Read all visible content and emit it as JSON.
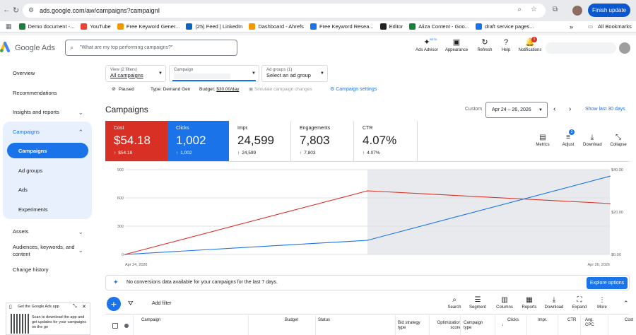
{
  "browser": {
    "url": "ads.google.com/aw/campaigns?campaignI",
    "finish_update": "Finish update",
    "bookmarks": [
      {
        "label": "Demo document -...",
        "color": "#188038"
      },
      {
        "label": "YouTube",
        "color": "#ea4335"
      },
      {
        "label": "Free Keyword Gener...",
        "color": "#f29900"
      },
      {
        "label": "(25) Feed | LinkedIn",
        "color": "#0a66c2"
      },
      {
        "label": "Dashboard - Ahrefs",
        "color": "#f29900"
      },
      {
        "label": "Free Keyword Resea...",
        "color": "#1a73e8"
      },
      {
        "label": "Editor",
        "color": "#202124"
      },
      {
        "label": "Aliza Content - Goo...",
        "color": "#188038"
      },
      {
        "label": "draft service pages...",
        "color": "#1a73e8"
      }
    ],
    "more_bookmarks": "»",
    "all_bookmarks": "All Bookmarks"
  },
  "header": {
    "brand": "Google Ads",
    "search_placeholder": "\"What are my top performing campaigns?\"",
    "icons": [
      {
        "label": "Ads Advisor",
        "glyph": "✦",
        "badge": "BETA"
      },
      {
        "label": "Appearance",
        "glyph": "▣"
      },
      {
        "label": "Refresh",
        "glyph": "↻"
      },
      {
        "label": "Help",
        "glyph": "?"
      },
      {
        "label": "Notifications",
        "glyph": "🔔",
        "badge": "1"
      }
    ]
  },
  "sidebar": {
    "overview": "Overview",
    "recommendations": "Recommendations",
    "insights": "Insights and reports",
    "campaigns_group": "Campaigns",
    "campaigns": "Campaigns",
    "ad_groups": "Ad groups",
    "ads": "Ads",
    "experiments": "Experiments",
    "assets": "Assets",
    "audiences": "Audiences, keywords, and content",
    "change_history": "Change history"
  },
  "filters": {
    "view_label": "View (2 filters)",
    "view_value": "All campaigns",
    "campaign_label": "Campaign",
    "adgroup_label": "Ad groups (1)",
    "adgroup_value": "Select an ad group"
  },
  "status_row": {
    "status": "Paused",
    "type": "Type: Demand Gen",
    "budget_prefix": "Budget:",
    "budget": "$30.00/day",
    "simulate": "Simulate campaign changes",
    "settings": "Campaign settings"
  },
  "page": {
    "title": "Campaigns",
    "custom": "Custom",
    "date_range": "Apr 24 – 26, 2026",
    "show_last": "Show last 30 days"
  },
  "metrics": [
    {
      "label": "Cost",
      "value": "$54.18",
      "sub": "$54.18",
      "bg": "#d93025",
      "fg": "#ffffff"
    },
    {
      "label": "Clicks",
      "value": "1,002",
      "sub": "1,002",
      "bg": "#1a73e8",
      "fg": "#ffffff"
    },
    {
      "label": "Impr.",
      "value": "24,599",
      "sub": "24,599",
      "bg": "#ffffff",
      "fg": "#202124"
    },
    {
      "label": "Engagements",
      "value": "7,803",
      "sub": "7,803",
      "bg": "#ffffff",
      "fg": "#202124"
    },
    {
      "label": "CTR",
      "value": "4.07%",
      "sub": "4.07%",
      "bg": "#ffffff",
      "fg": "#202124"
    }
  ],
  "chart_tools": [
    {
      "label": "Metrics",
      "glyph": "▤"
    },
    {
      "label": "Adjust",
      "glyph": "≡",
      "badge": "3"
    },
    {
      "label": "Download",
      "glyph": "⤓"
    },
    {
      "label": "Collapse",
      "glyph": "⤡"
    }
  ],
  "chart_data": {
    "type": "line",
    "x": [
      "Apr 24, 2026",
      "Apr 25, 2026",
      "Apr 26, 2026"
    ],
    "x_tick_labels": [
      "Apr 24, 2026",
      "Apr 26, 2026"
    ],
    "left_ticks": [
      "900",
      "600",
      "300",
      "0"
    ],
    "right_ticks": [
      "$40.00",
      "$20.00",
      "$0.00"
    ],
    "left_range": [
      0,
      900
    ],
    "right_range": [
      0,
      40
    ],
    "series": [
      {
        "values": [
          0,
          150,
          830
        ],
        "axis": "left",
        "color": "#1a73e8"
      },
      {
        "values": [
          0,
          30,
          24
        ],
        "axis": "right",
        "color": "#d93025"
      }
    ],
    "grid": true,
    "shaded_from": "Apr 25, 2026"
  },
  "notice": {
    "text": "No conversions data available for your campaigns for the last 7 days.",
    "button": "Explore options"
  },
  "table_toolbar": {
    "add_filter": "Add filter",
    "tools": [
      {
        "label": "Search",
        "glyph": "⌕"
      },
      {
        "label": "Segment",
        "glyph": "☰"
      },
      {
        "label": "Columns",
        "glyph": "▥"
      },
      {
        "label": "Reports",
        "glyph": "▦"
      },
      {
        "label": "Download",
        "glyph": "⤓"
      },
      {
        "label": "Expand",
        "glyph": "⛶"
      },
      {
        "label": "More",
        "glyph": "⋮"
      }
    ]
  },
  "table_headers": [
    "Campaign",
    "Budget",
    "Status",
    "Bid strategy type",
    "Optimization score",
    "Campaign type",
    "Clicks",
    "Impr.",
    "CTR",
    "Avg. CPC",
    "Cost"
  ],
  "qr_card": {
    "title": "Get the Google Ads app",
    "text": "Scan to download the app and get updates for your campaigns on the go"
  }
}
